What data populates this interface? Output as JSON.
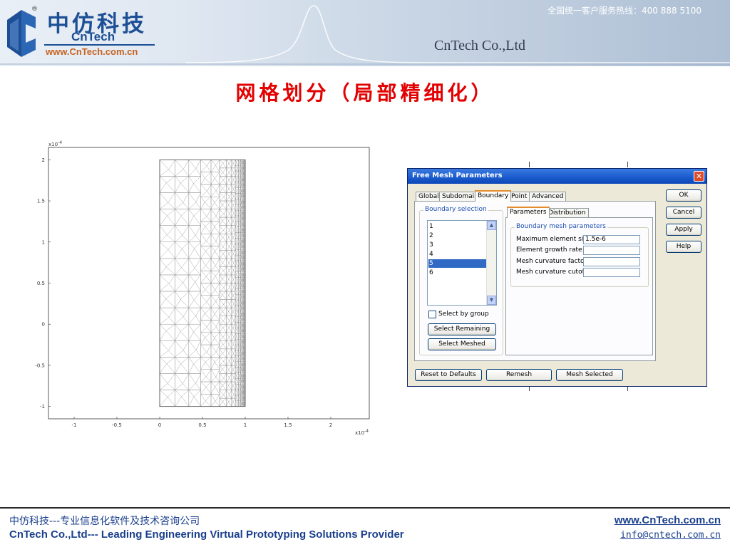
{
  "header": {
    "brand_cn": "中仿科技",
    "brand_en": "CnTech",
    "reg_mark": "®",
    "brand_url": "www.CnTech.com.cn",
    "hotline": "全国统一客户服务热线：400 888 5100",
    "company_en": "CnTech Co.,Ltd",
    "colors": {
      "brand_blue": "#1c4f95",
      "url_orange": "#c9621e"
    }
  },
  "slide": {
    "title": "网格划分（局部精细化）",
    "title_color": "#e30000"
  },
  "chart_data": {
    "type": "mesh",
    "x_ticks": [
      "-1",
      "-0.5",
      "0",
      "0.5",
      "1",
      "1.5",
      "2"
    ],
    "y_ticks": [
      "2",
      "1.5",
      "1",
      "0.5",
      "0",
      "-0.5",
      "-1"
    ],
    "x_multiplier": "x10",
    "x_exponent": "-4",
    "y_multiplier": "x10",
    "y_exponent": "-4",
    "xlim": [
      -1.3,
      2.45
    ],
    "ylim": [
      -1.15,
      2.15
    ],
    "domain": {
      "x": [
        0,
        1
      ],
      "y": [
        -1,
        2
      ]
    },
    "refined_edge": "right boundary (x = 1)",
    "grid": false
  },
  "dialog": {
    "title": "Free Mesh Parameters",
    "close_glyph": "✕",
    "tabs": [
      "Global",
      "Subdomain",
      "Boundary",
      "Point",
      "Advanced"
    ],
    "active_tab": "Boundary",
    "side_buttons": {
      "ok": "OK",
      "cancel": "Cancel",
      "apply": "Apply",
      "help": "Help"
    },
    "boundary_selection": {
      "label": "Boundary selection",
      "items": [
        "1",
        "2",
        "3",
        "4",
        "5",
        "6"
      ],
      "selected": "5",
      "select_by_group": "Select by group",
      "select_by_group_checked": false,
      "select_remaining": "Select Remaining",
      "select_meshed": "Select Meshed"
    },
    "subtabs": [
      "Parameters",
      "Distribution"
    ],
    "active_subtab": "Parameters",
    "mesh_params": {
      "group_label": "Boundary mesh parameters",
      "fields": [
        {
          "label": "Maximum element size:",
          "value": "1.5e-6"
        },
        {
          "label": "Element growth rate:",
          "value": ""
        },
        {
          "label": "Mesh curvature factor:",
          "value": ""
        },
        {
          "label": "Mesh curvature cutoff:",
          "value": ""
        }
      ]
    },
    "bottom_buttons": {
      "reset": "Reset to Defaults",
      "remesh": "Remesh",
      "mesh_selected": "Mesh Selected"
    }
  },
  "footer": {
    "cn": "中仿科技---专业信息化软件及技术咨询公司",
    "en": "CnTech Co.,Ltd--- Leading Engineering Virtual Prototyping Solutions Provider",
    "web": "www.CnTech.com.cn",
    "mail": "info@cntech.com.cn"
  }
}
